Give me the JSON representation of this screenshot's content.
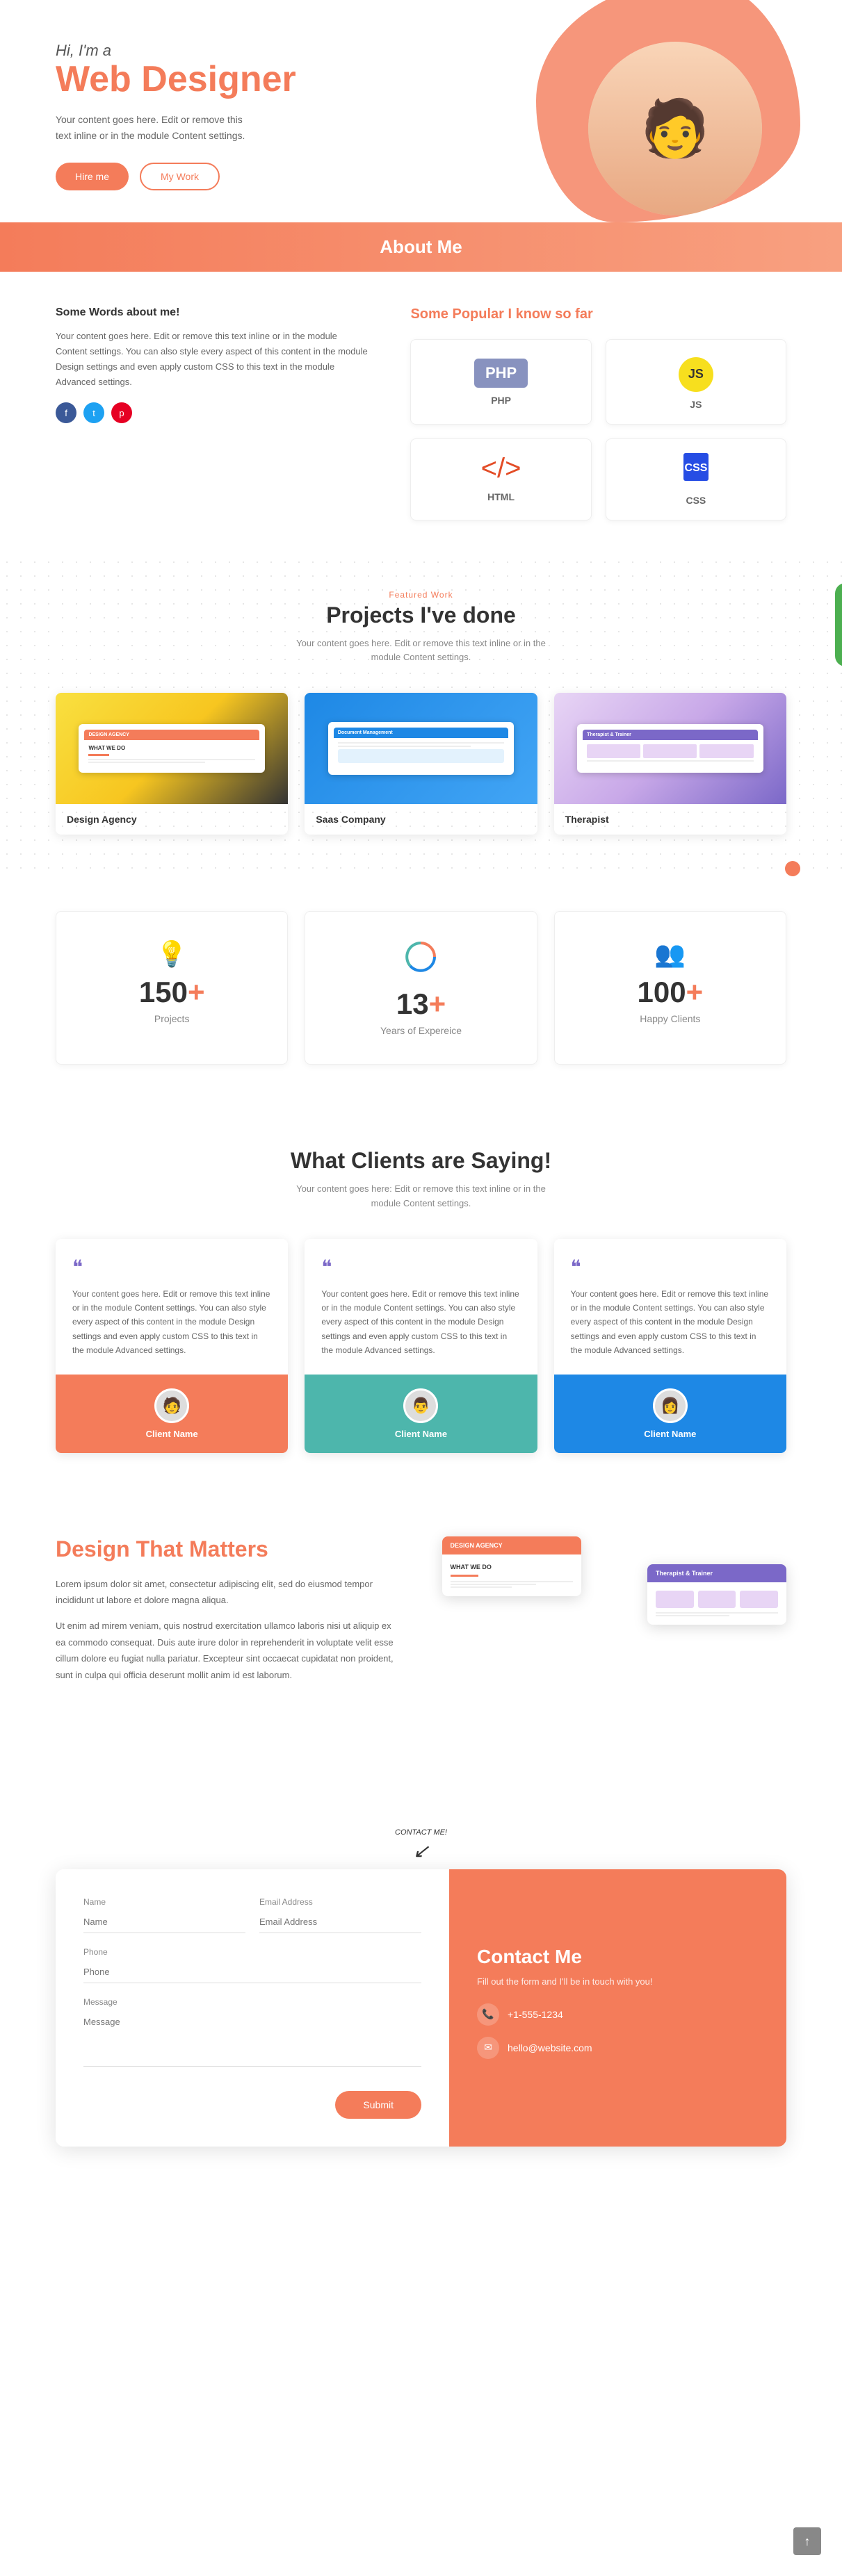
{
  "hero": {
    "greeting": "Hi, I'm a",
    "title": "Web Designer",
    "description": "Your content goes here. Edit or remove this text inline or in the module Content settings.",
    "btn_hire": "Hire me",
    "btn_work": "My Work"
  },
  "about": {
    "banner_title": "About Me",
    "left_heading": "Some Words about me!",
    "left_text": "Your content goes here. Edit or remove this text inline or in the module Content settings. You can also style every aspect of this content in the module Design settings and even apply custom CSS to this text in the module Advanced settings.",
    "popular_heading": "Some Popular I know so far",
    "skills": [
      {
        "name": "PHP",
        "icon_type": "php"
      },
      {
        "name": "JS",
        "icon_type": "js"
      },
      {
        "name": "HTML",
        "icon_type": "html"
      },
      {
        "name": "CSS",
        "icon_type": "css"
      }
    ]
  },
  "projects": {
    "tag": "Featured Work",
    "title": "Projects I've done",
    "description": "Your content goes here. Edit or remove this text inline or in the module Content settings.",
    "items": [
      {
        "name": "Design Agency",
        "type": "design"
      },
      {
        "name": "Saas Company",
        "type": "saas"
      },
      {
        "name": "Therapist",
        "type": "therapist"
      }
    ]
  },
  "stats": {
    "items": [
      {
        "number": "150+",
        "label": "Projects",
        "icon": "💡"
      },
      {
        "number": "13+",
        "label": "Years of Expereice",
        "icon": "⏱"
      },
      {
        "number": "100+",
        "label": "Happy Clients",
        "icon": "👥"
      }
    ]
  },
  "testimonials": {
    "title": "What Clients are Saying!",
    "description": "Your content goes here: Edit or remove this text inline or in the module Content settings.",
    "items": [
      {
        "text": "Your content goes here. Edit or remove this text inline or in the module Content settings. You can also style every aspect of this content in the module Design settings and even apply custom CSS to this text in the module Advanced settings.",
        "client": "Client Name",
        "color": "orange"
      },
      {
        "text": "Your content goes here. Edit or remove this text inline or in the module Content settings. You can also style every aspect of this content in the module Design settings and even apply custom CSS to this text in the module Advanced settings.",
        "client": "Client Name",
        "color": "teal"
      },
      {
        "text": "Your content goes here. Edit or remove this text inline or in the module Content settings. You can also style every aspect of this content in the module Design settings and even apply custom CSS to this text in the module Advanced settings.",
        "client": "Client Name",
        "color": "blue"
      }
    ]
  },
  "design": {
    "title": "Design That Matters",
    "para1": "Lorem ipsum dolor sit amet, consectetur adipiscing elit, sed do eiusmod tempor incididunt ut labore et dolore magna aliqua.",
    "para2": "Ut enim ad mirem veniam, quis nostrud exercitation ullamco laboris nisi ut aliquip ex ea commodo consequat. Duis aute irure dolor in reprehenderit in voluptate velit esse cillum dolore eu fugiat nulla pariatur. Excepteur sint occaecat cupidatat non proident, sunt in culpa qui officia deserunt mollit anim id est laborum."
  },
  "contact": {
    "arrow_label": "CONTACT ME!",
    "form": {
      "name_label": "Name",
      "email_label": "Email Address",
      "phone_label": "Phone",
      "message_label": "Message",
      "submit_label": "Submit"
    },
    "info": {
      "title": "Contact Me",
      "subtitle": "Fill out the form and I'll be in touch with you!",
      "phone": "+1-555-1234",
      "email": "hello@website.com"
    }
  }
}
